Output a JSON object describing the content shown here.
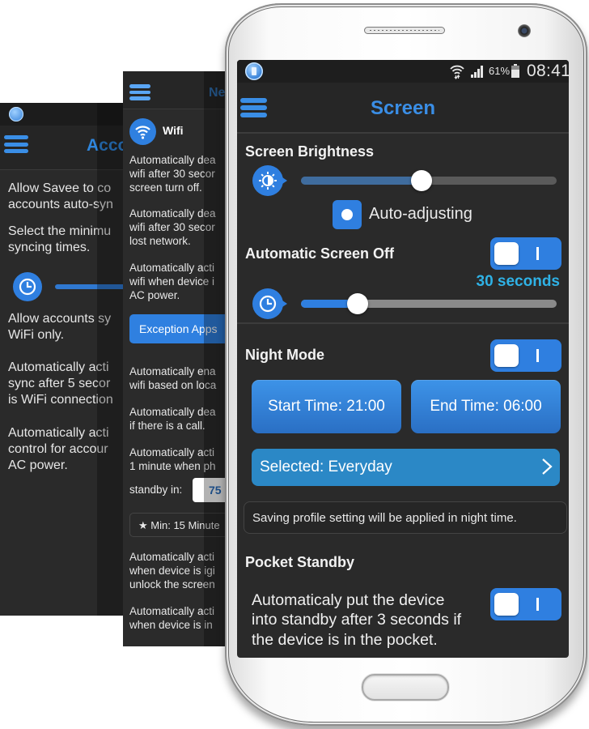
{
  "back_screen_accounts": {
    "title": "Acco",
    "lines": [
      "Allow Savee to co",
      "accounts auto-syn",
      "Select the minimu",
      "syncing times.",
      "Allow accounts sy",
      "WiFi only.",
      "Automatically acti",
      "sync after 5 secor",
      "is WiFi connection",
      "Automatically acti",
      "control for accour",
      "AC power."
    ]
  },
  "back_screen_network": {
    "title": "Ne",
    "section_label": "Wifi",
    "lines": [
      "Automatically dea",
      "wifi after 30 secor",
      "screen turn off.",
      "Automatically dea",
      "wifi after 30 secor",
      "lost network.",
      "Automatically acti",
      "wifi when device i",
      "AC power.",
      "Automatically ena",
      "wifi based on loca",
      "Automatically dea",
      "if there is a call.",
      "Automatically acti",
      "1 minute when ph",
      "standby in:",
      "Automatically acti",
      "when device is igi",
      "unlock the screen",
      "Automatically acti",
      "when device is in"
    ],
    "exception_button": "Exception Apps",
    "standby_value": "75",
    "min_label": "Min: 15 Minute"
  },
  "status_bar": {
    "battery_percent": "61%",
    "time": "08:41"
  },
  "app_bar": {
    "title": "Screen"
  },
  "brightness": {
    "title": "Screen Brightness",
    "level": 0.47,
    "auto_label": "Auto-adjusting",
    "auto_checked": true
  },
  "screen_off": {
    "title": "Automatic Screen Off",
    "enabled": true,
    "value_label": "30 seconds",
    "level": 0.22
  },
  "night_mode": {
    "title": "Night Mode",
    "enabled": true,
    "start_button": "Start Time: 21:00",
    "end_button": "End Time: 06:00",
    "days_button": "Selected: Everyday",
    "info": "Saving profile setting will be applied in night time."
  },
  "pocket_standby": {
    "title": "Pocket Standby",
    "enabled": true,
    "description_lines": [
      "Automaticaly put the device",
      "into standby after 3 seconds if",
      "the device is in the pocket."
    ]
  },
  "colors": {
    "accent": "#2f7fe0",
    "title_blue": "#3a8ee6",
    "seconds_cyan": "#2fb2e6",
    "brightness_fill": "#3f6c9e",
    "screenoff_fill": "#2f7fe0"
  }
}
